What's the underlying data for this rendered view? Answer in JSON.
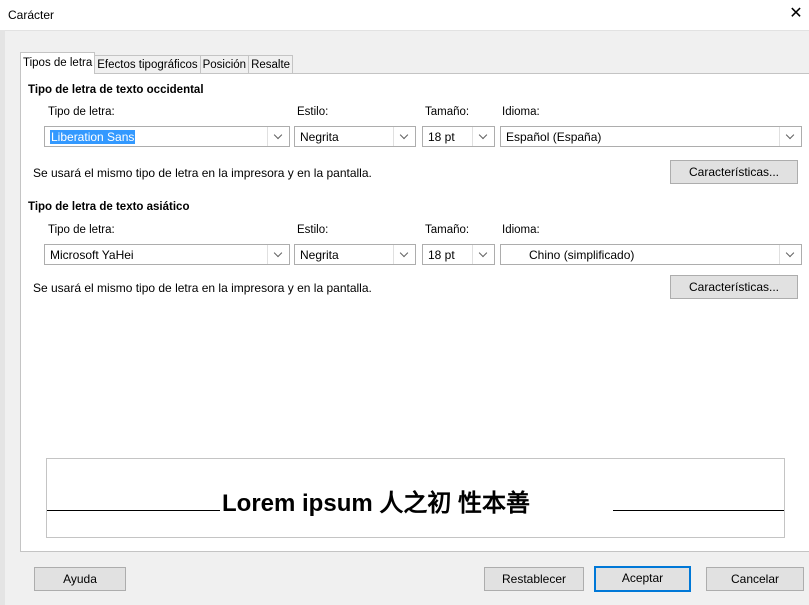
{
  "window": {
    "title": "Carácter",
    "close_icon": "close-icon"
  },
  "tabs": [
    {
      "label": "Tipos de letra",
      "active": true
    },
    {
      "label": "Efectos tipográficos",
      "active": false
    },
    {
      "label": "Posición",
      "active": false
    },
    {
      "label": "Resalte",
      "active": false
    }
  ],
  "western": {
    "heading": "Tipo de letra de texto occidental",
    "font_label": "Tipo de letra:",
    "style_label": "Estilo:",
    "size_label": "Tamaño:",
    "language_label": "Idioma:",
    "font_value": "Liberation Sans",
    "style_value": "Negrita",
    "size_value": "18 pt",
    "language_value": "Español (España)",
    "note": "Se usará el mismo tipo de letra en la impresora y en la pantalla.",
    "features_button": "Características..."
  },
  "asian": {
    "heading": "Tipo de letra de texto asiático",
    "font_label": "Tipo de letra:",
    "style_label": "Estilo:",
    "size_label": "Tamaño:",
    "language_label": "Idioma:",
    "font_value": "Microsoft YaHei",
    "style_value": "Negrita",
    "size_value": "18 pt",
    "language_value": "Chino (simplificado)",
    "note": "Se usará el mismo tipo de letra en la impresora y en la pantalla.",
    "features_button": "Características..."
  },
  "preview": {
    "text": "Lorem ipsum   人之初 性本善"
  },
  "footer": {
    "help": "Ayuda",
    "reset": "Restablecer",
    "ok": "Aceptar",
    "cancel": "Cancelar"
  },
  "colors": {
    "selection": "#3399ff",
    "default_button_border": "#0078d7"
  }
}
